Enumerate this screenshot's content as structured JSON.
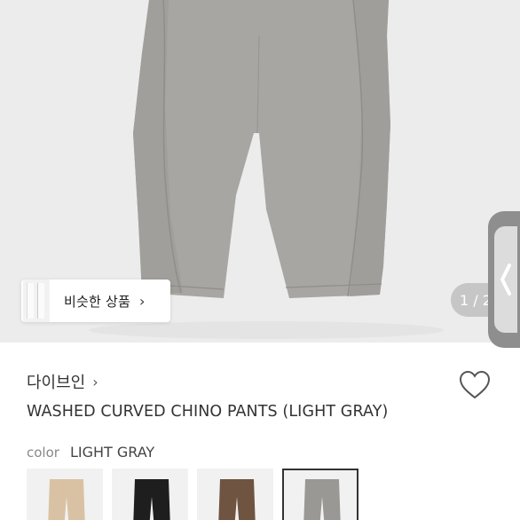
{
  "hero": {
    "page_counter": "1 / 2",
    "similar_products_label": "비슷한 상품"
  },
  "product": {
    "brand": "다이브인",
    "title": "WASHED CURVED CHINO PANTS (LIGHT GRAY)",
    "color_key": "color",
    "color_value": "LIGHT GRAY"
  },
  "swatches": [
    {
      "color": "#d9c2a3",
      "selected": false
    },
    {
      "color": "#1e1e1e",
      "selected": false
    },
    {
      "color": "#6e5441",
      "selected": false
    },
    {
      "color": "#9a9895",
      "selected": true
    }
  ],
  "colors": {
    "pants_main": "#a7a6a2",
    "hero_bg": "#ececec"
  },
  "icons": {
    "heart": "heart-icon",
    "chevron_right": "chevron-right-icon",
    "chevron_left": "chevron-left-icon"
  }
}
